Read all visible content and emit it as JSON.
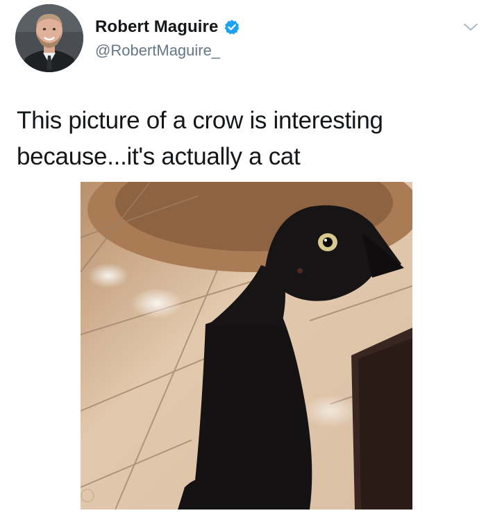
{
  "tweet": {
    "author": {
      "display_name": "Robert Maguire",
      "handle": "@RobertMaguire_",
      "verified": true,
      "verified_icon": "verified-badge-icon",
      "avatar_icon": "avatar"
    },
    "menu_icon": "chevron-down-icon",
    "text_line1": "This picture of a crow is interesting",
    "text_line2": "because...it's actually a cat",
    "media_alt": "black cat photo"
  },
  "colors": {
    "verified_blue": "#1da1f2",
    "text_primary": "#14171a",
    "text_secondary": "#657786"
  }
}
